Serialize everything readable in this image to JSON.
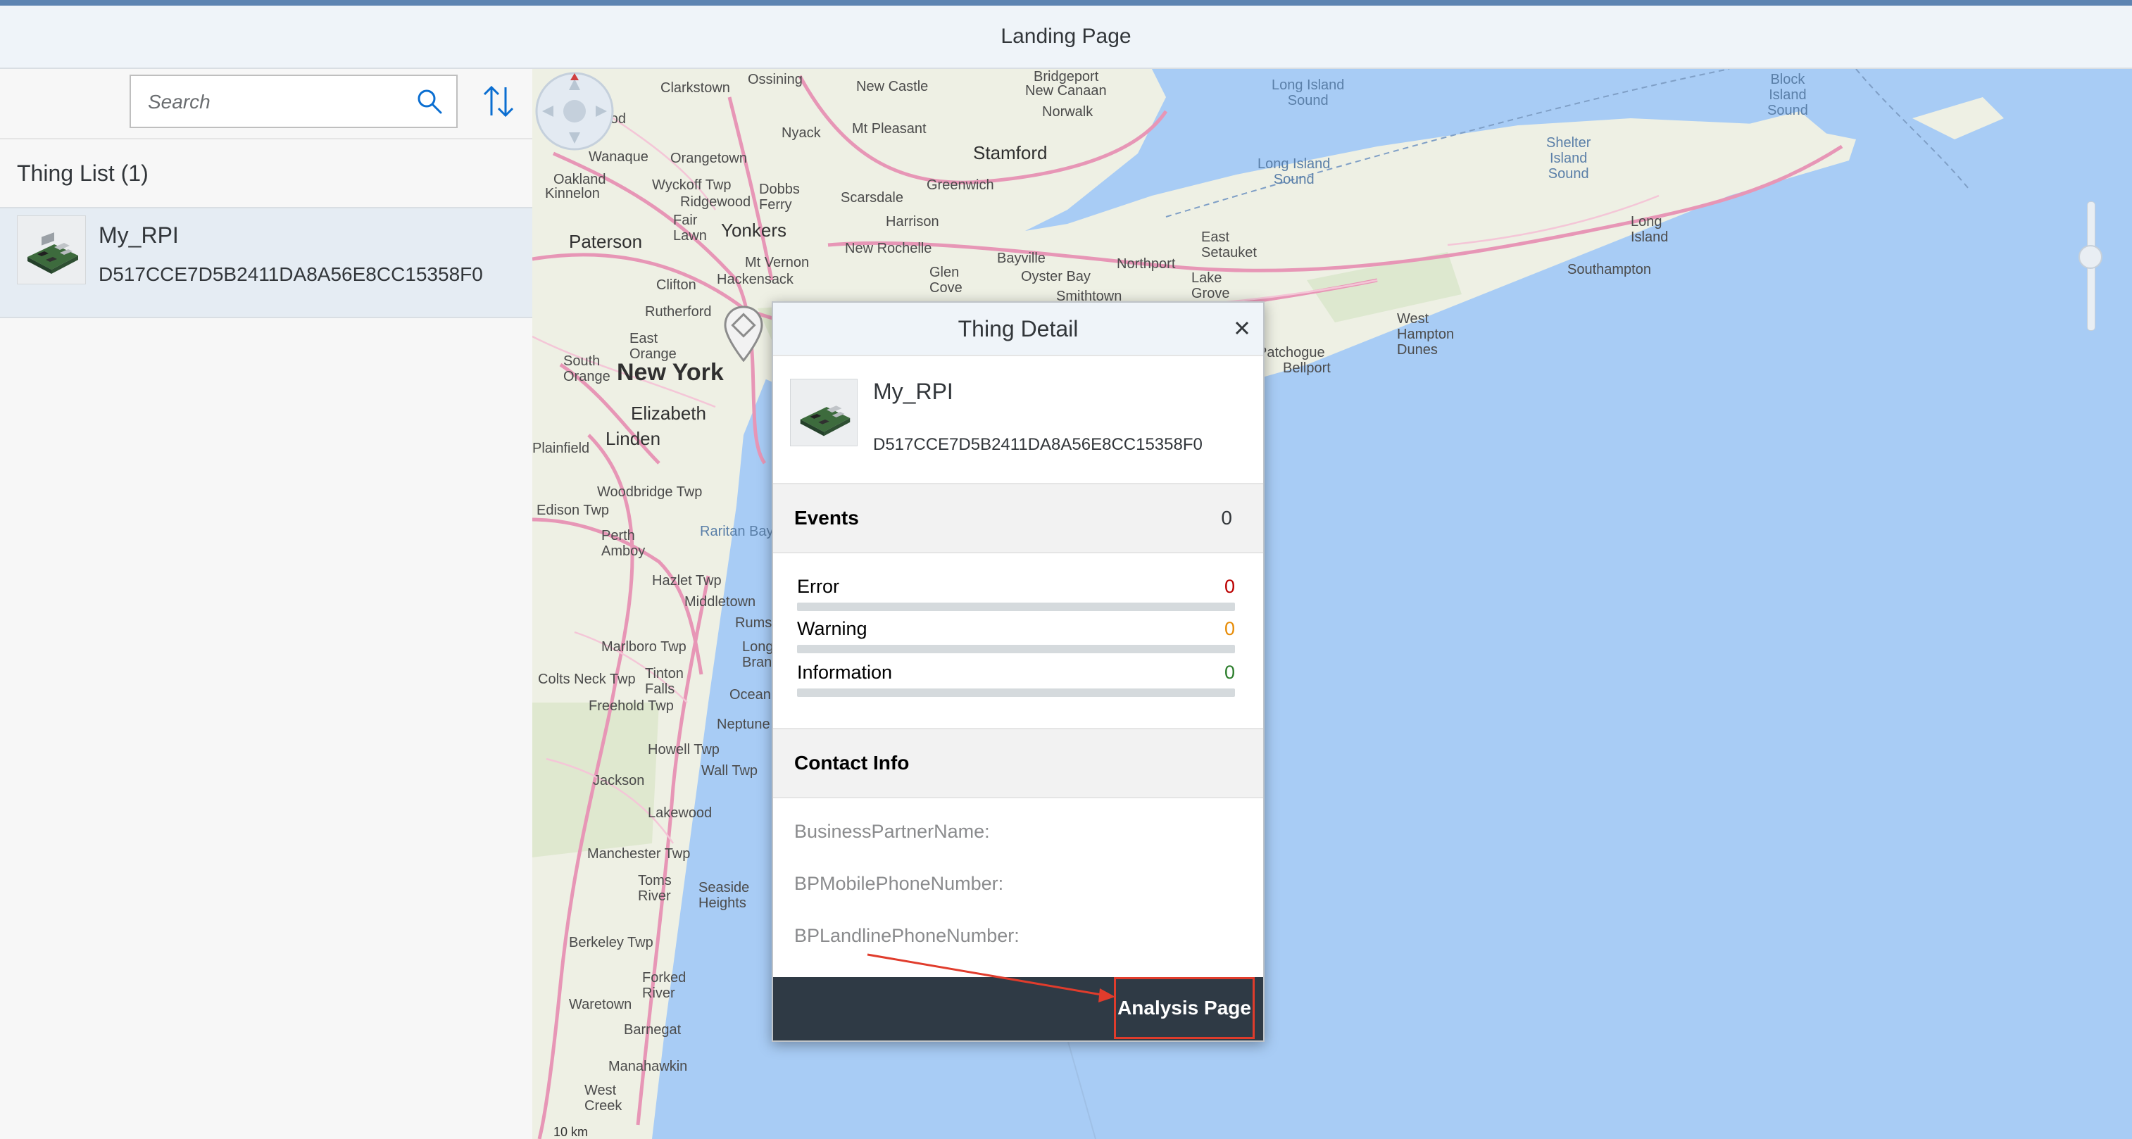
{
  "shell": {
    "title": "Landing Page"
  },
  "master": {
    "search_placeholder": "Search",
    "list_header": "Thing List (1)",
    "items": [
      {
        "name": "My_RPI",
        "id": "D517CCE7D5B2411DA8A56E8CC15358F0"
      }
    ]
  },
  "map": {
    "labels": {
      "new_york": "New York",
      "paterson": "Paterson",
      "yonkers": "Yonkers",
      "stamford": "Stamford",
      "elizabeth": "Elizabeth",
      "long_island": "Long\nIsland",
      "southampton": "Southampton",
      "long_island_sound_1": "Long Island\nSound",
      "long_island_sound_2": "Long Island\nSound",
      "block_island_sound": "Block\nIsland\nSound",
      "shelter_island_sound": "Shelter\nIsland\nSound",
      "new_rochelle": "New Rochelle",
      "greenwich": "Greenwich",
      "norwalk": "Norwalk",
      "east_setauket": "East\nSetauket",
      "west_hampton_dunes": "West\nHampton\nDunes",
      "lakewood": "Lakewood",
      "toms_river": "Toms\nRiver",
      "middletown": "Middletown",
      "freehold_twp": "Freehold Twp",
      "marlboro_twp": "Marlboro Twp",
      "howell_twp": "Howell Twp",
      "jackson": "Jackson",
      "manchester_twp": "Manchester Twp",
      "berkeley_twp": "Berkeley Twp",
      "waretown": "Waretown",
      "barnegat": "Barnegat",
      "manahawkin": "Manahawkin",
      "west_creek": "West\nCreek",
      "seaside_heights": "Seaside\nHeights",
      "forked_river": "Forked\nRiver",
      "woodbridge_twp": "Woodbridge Twp",
      "edison_twp": "Edison Twp",
      "perth_amboy": "Perth\nAmboy",
      "hazlet_twp": "Hazlet Twp",
      "linden": "Linden",
      "plainfield": "Plainfield",
      "rutherford": "Rutherford",
      "clifton": "Clifton",
      "east_orange": "East\nOrange",
      "mt_vernon": "Mt Vernon",
      "hackensack": "Hackensack",
      "bayville": "Bayville",
      "northport": "Northport",
      "lake_grove": "Lake\nGrove",
      "bellport": "Bellport",
      "patchogue": "Patchogue",
      "smithtown": "Smithtown",
      "oyster_bay": "Oyster Bay",
      "glen_cove": "Glen\nCove",
      "harrison": "Harrison",
      "scarsdale": "Scarsdale",
      "mt_pleasant": "Mt Pleasant",
      "new_castle": "New Castle",
      "new_canaan": "New Canaan",
      "nyack": "Nyack",
      "clarkstown": "Clarkstown",
      "ossining": "Ossining",
      "orangetown": "Orangetown",
      "ringwood": "Ringwood",
      "wanaque": "Wanaque",
      "oakland": "Oakland",
      "kinnelon": "Kinnelon",
      "wyckoff_twp": "Wyckoff Twp",
      "ridgewood": "Ridgewood",
      "dobbs_ferry": "Dobbs\nFerry",
      "fair_lawn": "Fair\nLawn",
      "bridgeport": "Bridgeport",
      "raritan_bay": "Raritan Bay",
      "tinton_falls": "Tinton\nFalls",
      "colts_neck_twp": "Colts Neck Twp",
      "neptune": "Neptune",
      "wall_twp": "Wall Twp",
      "ocean": "Ocean",
      "long_branch": "Long\nBranch",
      "rumson": "Rumson",
      "south_orange": "South\nOrange",
      "scale": "10 km"
    }
  },
  "popover": {
    "title": "Thing Detail",
    "name": "My_RPI",
    "id": "D517CCE7D5B2411DA8A56E8CC15358F0",
    "events": {
      "title": "Events",
      "count": "0",
      "rows": [
        {
          "label": "Error",
          "value": "0",
          "color": "#bb0000",
          "fraction": 0
        },
        {
          "label": "Warning",
          "value": "0",
          "color": "#e78c07",
          "fraction": 0
        },
        {
          "label": "Information",
          "value": "0",
          "color": "#2b7d2b",
          "fraction": 0
        }
      ]
    },
    "contact": {
      "title": "Contact Info",
      "business_partner_name": "BusinessPartnerName:",
      "bp_mobile": "BPMobilePhoneNumber:",
      "bp_landline": "BPLandlinePhoneNumber:"
    },
    "footer": {
      "analysis_button": "Analysis Page"
    }
  },
  "colors": {
    "accent_topline": "#5d84b2",
    "shell_bg": "#eff4f9",
    "water": "#a8ccf5",
    "land": "#eef0e4",
    "footer_bg": "#2f3a45",
    "annotation_red": "#e03c2c"
  }
}
